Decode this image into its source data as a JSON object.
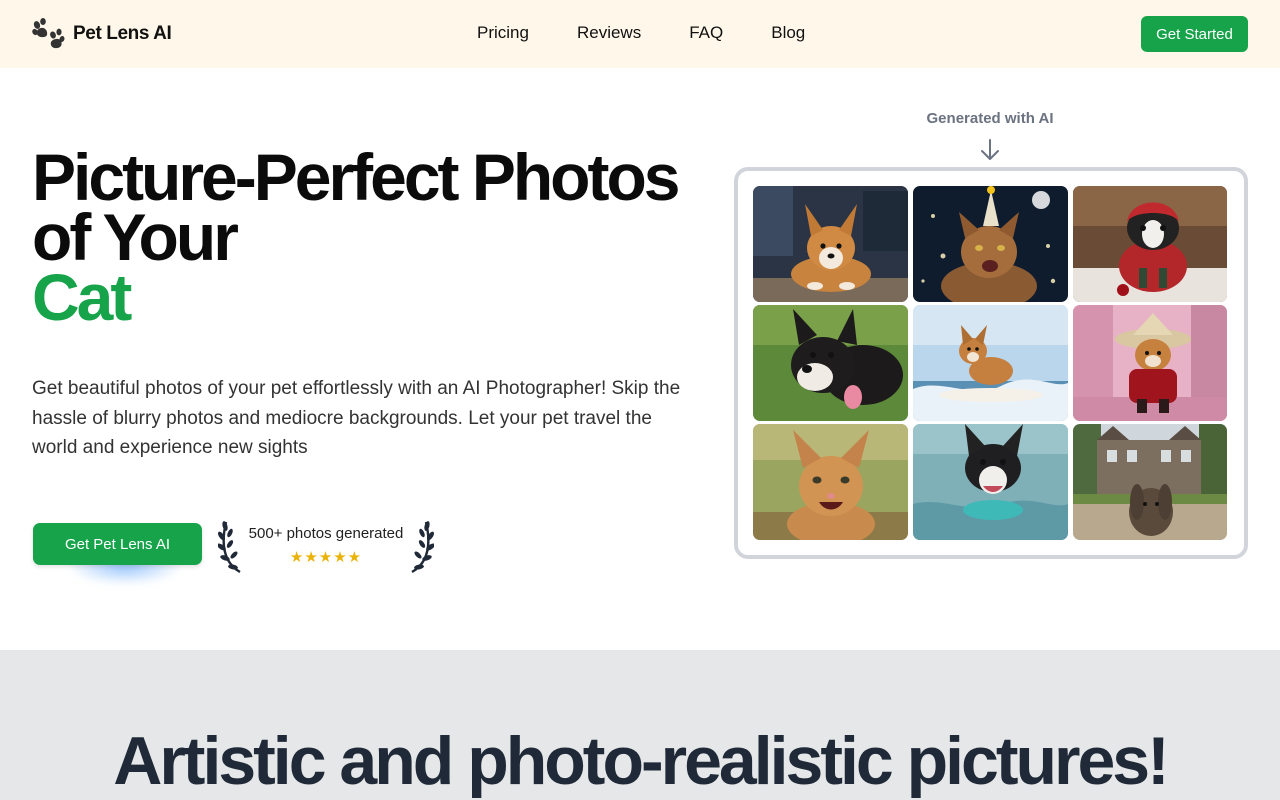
{
  "nav": {
    "brand": "Pet Lens AI",
    "links": [
      "Pricing",
      "Reviews",
      "FAQ",
      "Blog"
    ],
    "cta": "Get Started"
  },
  "hero": {
    "title_line1": "Picture-Perfect Photos",
    "title_line2": "of Your",
    "title_accent": "Cat",
    "description": "Get beautiful photos of your pet effortlessly with an AI Photographer! Skip the hassle of blurry photos and mediocre backgrounds. Let your pet travel the world and experience new sights",
    "cta": "Get Pet Lens AI",
    "badge_text": "500+ photos generated",
    "badge_stars": "★★★★★",
    "rating_stars": 5
  },
  "gallery": {
    "label": "Generated with AI",
    "photos": [
      "corgi-indoor-photo",
      "cat-party-hat-space-photo",
      "boston-terrier-red-hood-photo",
      "shiba-puppy-grass-photo",
      "corgi-surfing-photo",
      "corgi-straw-hat-cherry-blossom-photo",
      "kitten-smiling-field-photo",
      "boston-terrier-swimming-photo",
      "rabbit-manor-lawn-photo"
    ]
  },
  "section2": {
    "title": "Artistic and photo-realistic pictures!"
  },
  "colors": {
    "accent": "#16a34a",
    "nav_bg": "#fff8ea",
    "section_bg": "#e5e7e8",
    "star": "#eab308"
  }
}
